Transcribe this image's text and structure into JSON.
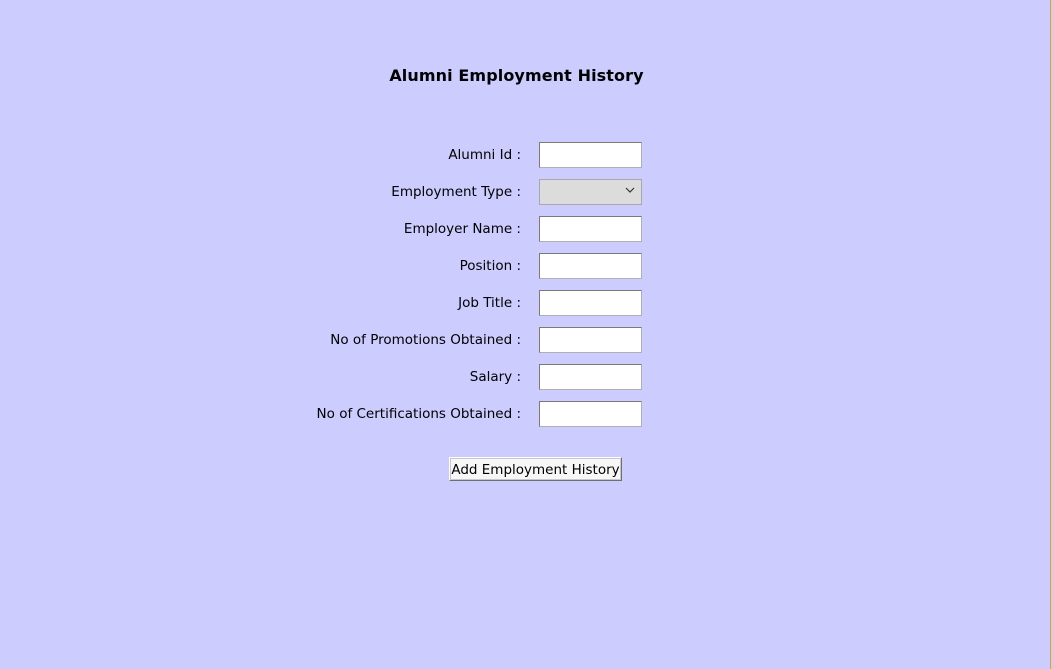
{
  "form": {
    "title": "Alumni Employment History",
    "fields": [
      {
        "label": "Alumni Id :",
        "value": "",
        "type": "text"
      },
      {
        "label": "Employment Type :",
        "value": "",
        "type": "select"
      },
      {
        "label": "Employer Name :",
        "value": "",
        "type": "text"
      },
      {
        "label": "Position :",
        "value": "",
        "type": "text"
      },
      {
        "label": "Job Title :",
        "value": "",
        "type": "text"
      },
      {
        "label": "No of Promotions Obtained :",
        "value": "",
        "type": "text"
      },
      {
        "label": "Salary :",
        "value": "",
        "type": "text"
      },
      {
        "label": "No of Certifications Obtained :",
        "value": "",
        "type": "text"
      }
    ],
    "submit_label": "Add Employment History"
  },
  "colors": {
    "background": "#ccccff",
    "input_background": "#ffffff",
    "select_background": "#dcdcdc",
    "button_background": "#f7f7f7"
  }
}
